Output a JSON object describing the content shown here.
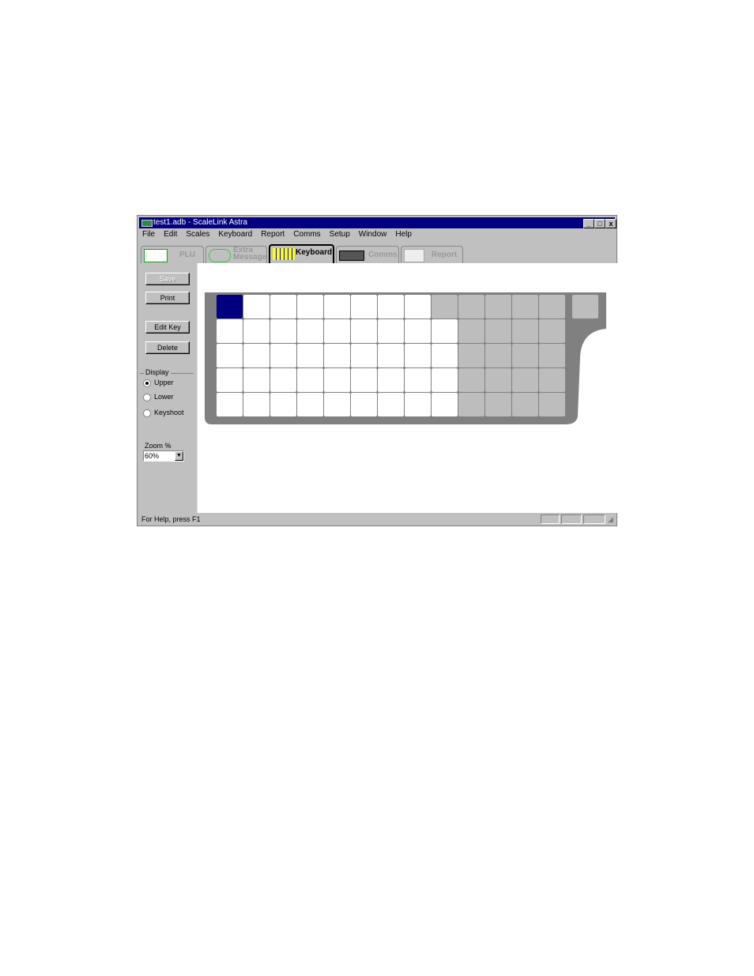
{
  "window": {
    "title": "test1.adb - ScaleLink Astra",
    "buttons": {
      "minimize": "_",
      "maximize": "□",
      "close": "x"
    }
  },
  "menu": [
    "File",
    "Edit",
    "Scales",
    "Keyboard",
    "Report",
    "Comms",
    "Setup",
    "Window",
    "Help"
  ],
  "tabs": [
    {
      "label": "PLU",
      "icon": "barcode-label-icon",
      "active": false
    },
    {
      "label": "Extra Message",
      "icon": "magnifier-message-icon",
      "active": false
    },
    {
      "label": "Keyboard",
      "icon": "keyboard-icon",
      "active": true
    },
    {
      "label": "Comms",
      "icon": "scale-device-icon",
      "active": false
    },
    {
      "label": "Report",
      "icon": "report-table-icon",
      "active": false
    }
  ],
  "sidebar": {
    "save": "Save",
    "print": "Print",
    "edit_key": "Edit Key",
    "delete": "Delete",
    "display_label": "Display",
    "display_options": [
      {
        "label": "Upper",
        "checked": true
      },
      {
        "label": "Lower",
        "checked": false
      },
      {
        "label": "Keyshoot",
        "checked": false
      }
    ],
    "zoom_label": "Zoom %",
    "zoom_value": "60%"
  },
  "keyboard": {
    "colors": {
      "selected": "#000080",
      "blank": "#ffffff",
      "disabled": "#bdbdbd",
      "body": "#808080"
    },
    "rows": [
      [
        "selected",
        "blank",
        "blank",
        "blank",
        "blank",
        "blank",
        "blank",
        "blank",
        "disabled",
        "disabled",
        "disabled",
        "disabled",
        "disabled"
      ],
      [
        "blank",
        "blank",
        "blank",
        "blank",
        "blank",
        "blank",
        "blank",
        "blank",
        "blank",
        "disabled",
        "disabled",
        "disabled",
        "disabled"
      ],
      [
        "blank",
        "blank",
        "blank",
        "blank",
        "blank",
        "blank",
        "blank",
        "blank",
        "blank",
        "disabled",
        "disabled",
        "disabled",
        "disabled"
      ],
      [
        "blank",
        "blank",
        "blank",
        "blank",
        "blank",
        "blank",
        "blank",
        "blank",
        "blank",
        "disabled",
        "disabled",
        "disabled",
        "disabled"
      ],
      [
        "blank",
        "blank",
        "blank",
        "blank",
        "blank",
        "blank",
        "blank",
        "blank",
        "blank",
        "disabled",
        "disabled",
        "disabled",
        "disabled"
      ]
    ],
    "extra_key": "disabled"
  },
  "status": {
    "text": "For Help, press F1"
  }
}
